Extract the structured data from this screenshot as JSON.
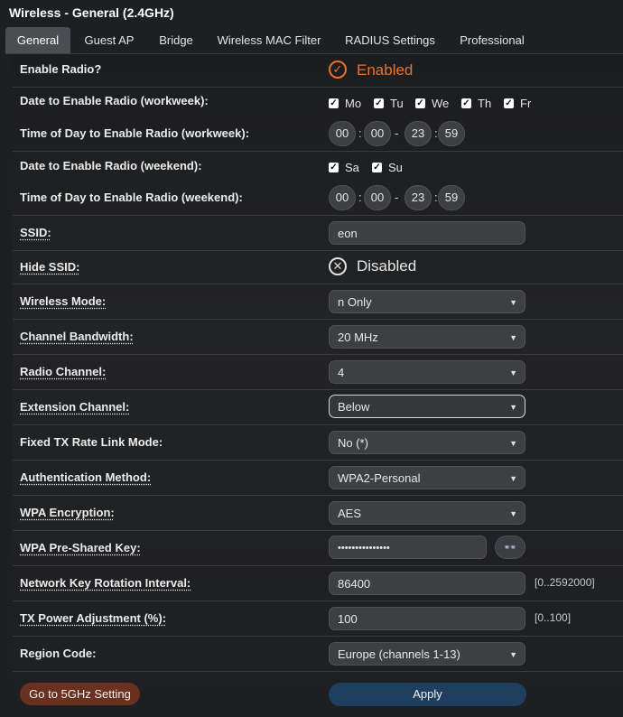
{
  "page_title": "Wireless - General (2.4GHz)",
  "tabs": [
    {
      "label": "General",
      "active": true
    },
    {
      "label": "Guest AP"
    },
    {
      "label": "Bridge"
    },
    {
      "label": "Wireless MAC Filter"
    },
    {
      "label": "RADIUS Settings"
    },
    {
      "label": "Professional"
    }
  ],
  "enable_radio": {
    "label": "Enable Radio?",
    "state": "Enabled",
    "color": "#e8732e"
  },
  "workweek_days": {
    "label": "Date to Enable Radio (workweek):",
    "days": [
      {
        "label": "Mo",
        "checked": true
      },
      {
        "label": "Tu",
        "checked": true
      },
      {
        "label": "We",
        "checked": true
      },
      {
        "label": "Th",
        "checked": true
      },
      {
        "label": "Fr",
        "checked": true
      }
    ]
  },
  "workweek_time": {
    "label": "Time of Day to Enable Radio (workweek):",
    "start_h": "00",
    "start_m": "00",
    "end_h": "23",
    "end_m": "59",
    "colon": ":",
    "dash": "-"
  },
  "weekend_days": {
    "label": "Date to Enable Radio (weekend):",
    "days": [
      {
        "label": "Sa",
        "checked": true
      },
      {
        "label": "Su",
        "checked": true
      }
    ]
  },
  "weekend_time": {
    "label": "Time of Day to Enable Radio (weekend):",
    "start_h": "00",
    "start_m": "00",
    "end_h": "23",
    "end_m": "59",
    "colon": ":",
    "dash": "-"
  },
  "ssid": {
    "label": "SSID:",
    "value": "eon"
  },
  "hide_ssid": {
    "label": "Hide SSID:",
    "state": "Disabled",
    "color": "#e0e0e0"
  },
  "wireless_mode": {
    "label": "Wireless Mode:",
    "value": "n Only"
  },
  "channel_bandwidth": {
    "label": "Channel Bandwidth:",
    "value": "20 MHz"
  },
  "radio_channel": {
    "label": "Radio Channel:",
    "value": "4"
  },
  "extension_channel": {
    "label": "Extension Channel:",
    "value": "Below"
  },
  "fixed_tx": {
    "label": "Fixed TX Rate Link Mode:",
    "value": "No (*)"
  },
  "auth_method": {
    "label": "Authentication Method:",
    "value": "WPA2-Personal"
  },
  "wpa_encryption": {
    "label": "WPA Encryption:",
    "value": "AES"
  },
  "wpa_psk": {
    "label": "WPA Pre-Shared Key:",
    "value": "•••••••••••••••"
  },
  "key_rotation": {
    "label": "Network Key Rotation Interval:",
    "value": "86400",
    "range": "[0..2592000]"
  },
  "tx_power": {
    "label": "TX Power Adjustment (%):",
    "value": "100",
    "range": "[0..100]"
  },
  "region_code": {
    "label": "Region Code:",
    "value": "Europe (channels 1-13)"
  },
  "buttons": {
    "goto5g": "Go to 5GHz Setting",
    "apply": "Apply"
  },
  "icons": {
    "check": "✓",
    "cross": "✕",
    "arrow": "▼",
    "eye": "👓"
  }
}
